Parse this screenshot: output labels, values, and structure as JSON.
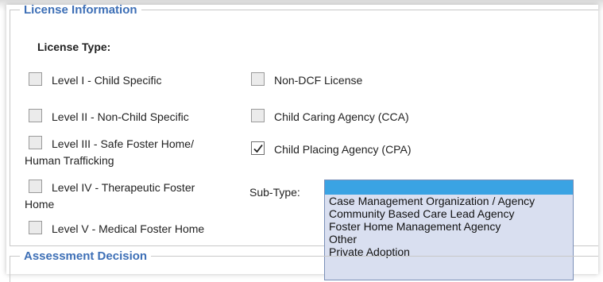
{
  "license_section": {
    "legend": "License Information",
    "license_type_label": "License Type:",
    "left_options": [
      {
        "line1": "Level I - Child Specific",
        "line2": "",
        "checked": false
      },
      {
        "line1": "Level II - Non-Child Specific",
        "line2": "",
        "checked": false
      },
      {
        "line1": "Level III - Safe Foster Home/",
        "line2": "Human Trafficking",
        "checked": false
      },
      {
        "line1": "Level IV - Therapeutic Foster",
        "line2": "Home",
        "checked": false
      },
      {
        "line1": "Level V - Medical Foster Home",
        "line2": "",
        "checked": false
      }
    ],
    "right_options": [
      {
        "label": "Non-DCF License",
        "checked": false
      },
      {
        "label": "Child Caring Agency (CCA)",
        "checked": false
      },
      {
        "label": "Child Placing Agency (CPA)",
        "checked": true
      }
    ],
    "subtype_label": "Sub-Type:",
    "subtype_selected": "",
    "subtype_options": [
      "Case Management Organization / Agency",
      "Community Based Care Lead Agency",
      "Foster Home Management Agency",
      "Other",
      "Private Adoption"
    ]
  },
  "assessment_section": {
    "legend": "Assessment Decision"
  },
  "colors": {
    "legend": "#3d6fb6",
    "selected_option": "#3aa3e3",
    "listbox_bg": "#d9dff0"
  }
}
